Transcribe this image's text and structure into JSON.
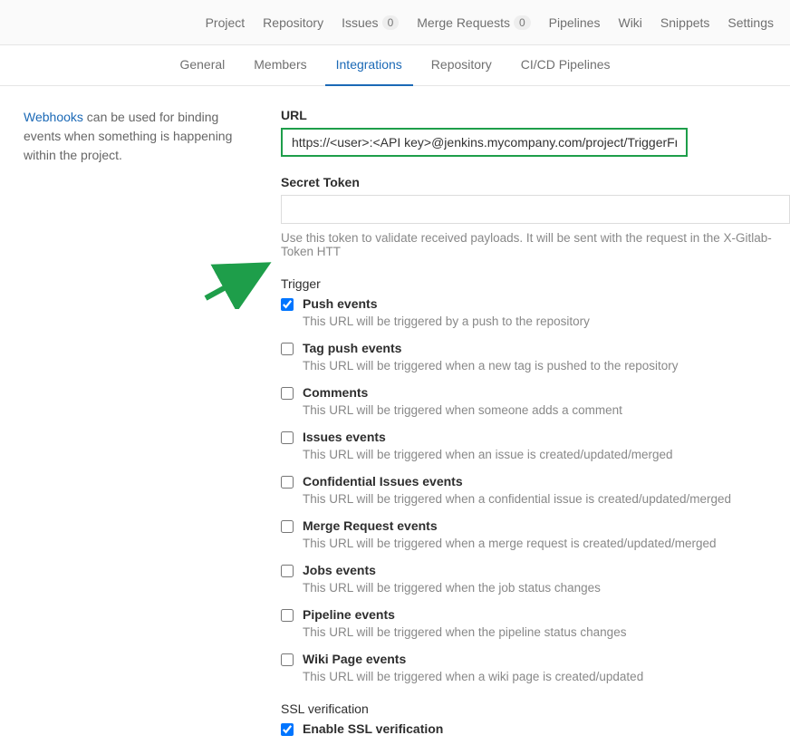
{
  "topnav": {
    "items": [
      {
        "label": "Project"
      },
      {
        "label": "Repository"
      },
      {
        "label": "Issues",
        "badge": "0"
      },
      {
        "label": "Merge Requests",
        "badge": "0"
      },
      {
        "label": "Pipelines"
      },
      {
        "label": "Wiki"
      },
      {
        "label": "Snippets"
      },
      {
        "label": "Settings"
      }
    ]
  },
  "subnav": {
    "items": [
      {
        "label": "General",
        "active": false
      },
      {
        "label": "Members",
        "active": false
      },
      {
        "label": "Integrations",
        "active": true
      },
      {
        "label": "Repository",
        "active": false
      },
      {
        "label": "CI/CD Pipelines",
        "active": false
      }
    ]
  },
  "side": {
    "link_text": "Webhooks",
    "rest": " can be used for binding events when something is happening within the project."
  },
  "url": {
    "label": "URL",
    "value": "https://<user>:<API key>@jenkins.mycompany.com/project/TriggerFreestyle"
  },
  "secret": {
    "label": "Secret Token",
    "value": "",
    "help": "Use this token to validate received payloads. It will be sent with the request in the X-Gitlab-Token HTT"
  },
  "trigger": {
    "label": "Trigger",
    "items": [
      {
        "title": "Push events",
        "desc": "This URL will be triggered by a push to the repository",
        "checked": true
      },
      {
        "title": "Tag push events",
        "desc": "This URL will be triggered when a new tag is pushed to the repository",
        "checked": false
      },
      {
        "title": "Comments",
        "desc": "This URL will be triggered when someone adds a comment",
        "checked": false
      },
      {
        "title": "Issues events",
        "desc": "This URL will be triggered when an issue is created/updated/merged",
        "checked": false
      },
      {
        "title": "Confidential Issues events",
        "desc": "This URL will be triggered when a confidential issue is created/updated/merged",
        "checked": false
      },
      {
        "title": "Merge Request events",
        "desc": "This URL will be triggered when a merge request is created/updated/merged",
        "checked": false
      },
      {
        "title": "Jobs events",
        "desc": "This URL will be triggered when the job status changes",
        "checked": false
      },
      {
        "title": "Pipeline events",
        "desc": "This URL will be triggered when the pipeline status changes",
        "checked": false
      },
      {
        "title": "Wiki Page events",
        "desc": "This URL will be triggered when a wiki page is created/updated",
        "checked": false
      }
    ]
  },
  "ssl": {
    "label": "SSL verification",
    "item": {
      "title": "Enable SSL verification",
      "checked": true
    }
  }
}
